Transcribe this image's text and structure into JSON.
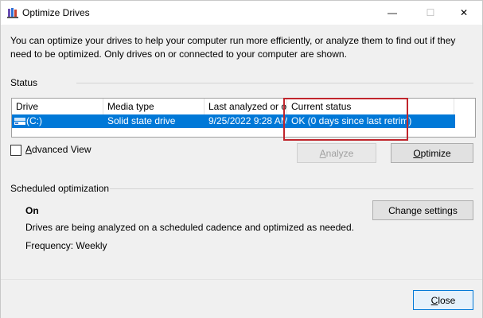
{
  "window": {
    "title": "Optimize Drives",
    "minimize_glyph": "—",
    "maximize_glyph": "☐",
    "close_glyph": "✕"
  },
  "description": "You can optimize your drives to help your computer run more efficiently, or analyze them to find out if they need to be optimized. Only drives on or connected to your computer are shown.",
  "status": {
    "section_label": "Status",
    "columns": [
      "Drive",
      "Media type",
      "Last analyzed or o...",
      "Current status"
    ],
    "rows": [
      {
        "drive": "(C:)",
        "media_type": "Solid state drive",
        "last_analyzed": "9/25/2022 9:28 AM",
        "current_status": "OK (0 days since last retrim)"
      }
    ],
    "highlight_color": "#c0262d",
    "selection_color": "#0078d7"
  },
  "advanced_view": {
    "label_prefix": "A",
    "label_rest": "dvanced View",
    "checked": false
  },
  "buttons": {
    "analyze_prefix": "A",
    "analyze_rest": "nalyze",
    "optimize_prefix": "O",
    "optimize_rest": "ptimize",
    "change_settings": "Change settings",
    "close_prefix": "C",
    "close_rest": "lose"
  },
  "scheduled": {
    "section_label": "Scheduled optimization",
    "state": "On",
    "description": "Drives are being analyzed on a scheduled cadence and optimized as needed.",
    "frequency": "Frequency: Weekly"
  },
  "icons": {
    "app": "defrag-icon",
    "drive": "drive-icon"
  }
}
